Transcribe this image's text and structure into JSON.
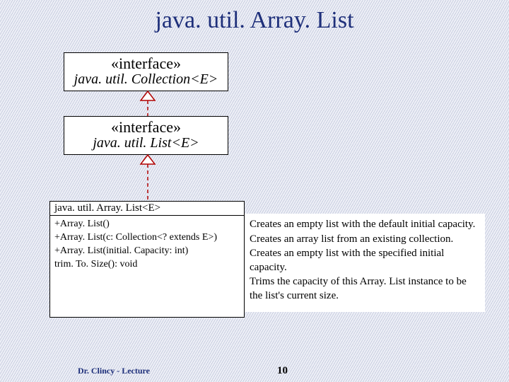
{
  "title": "java. util. Array. List",
  "uml": {
    "iface1": {
      "stereo": "«interface»",
      "name": "java. util. Collection<E>"
    },
    "iface2": {
      "stereo": "«interface»",
      "name": "java. util. List<E>"
    },
    "class": {
      "name": "java. util. Array. List<E>",
      "ops": [
        "+Array. List()",
        "+Array. List(c: Collection<? extends E>)",
        "+Array. List(initial. Capacity: int)",
        "  trim. To. Size(): void"
      ]
    },
    "desc": [
      "Creates an empty list with the default initial capacity.",
      "Creates an array list from an existing collection.",
      "Creates an empty list with the specified initial capacity.",
      "Trims the capacity of this Array. List instance to be the list's current size."
    ]
  },
  "footer": {
    "author": "Dr. Clincy - Lecture",
    "page": "10"
  }
}
